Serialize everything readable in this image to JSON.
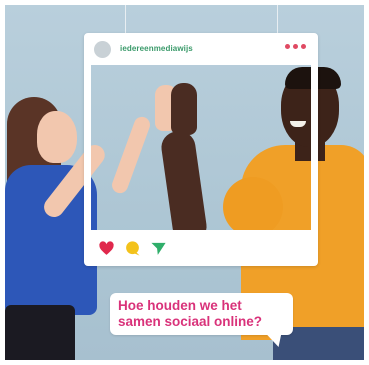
{
  "post": {
    "handle": "iedereenmediawijs"
  },
  "bubble": {
    "line1": "Hoe houden we het",
    "line2": "samen sociaal online?"
  },
  "colors": {
    "background": "#adc6d4",
    "frame": "#ffffff",
    "handle_green": "#3a9a6a",
    "accent_pink": "#d9327a",
    "dot_red": "#e04a63",
    "heart_red": "#e0284c",
    "comment_yellow": "#f3c21b",
    "send_green": "#2fae6a",
    "shirt_blue": "#2d57b8",
    "shirt_orange": "#f0a028"
  },
  "icons": {
    "header": [
      "avatar-circle",
      "more-dots-icon"
    ],
    "actions": [
      "heart-icon",
      "comment-icon",
      "send-icon"
    ]
  }
}
